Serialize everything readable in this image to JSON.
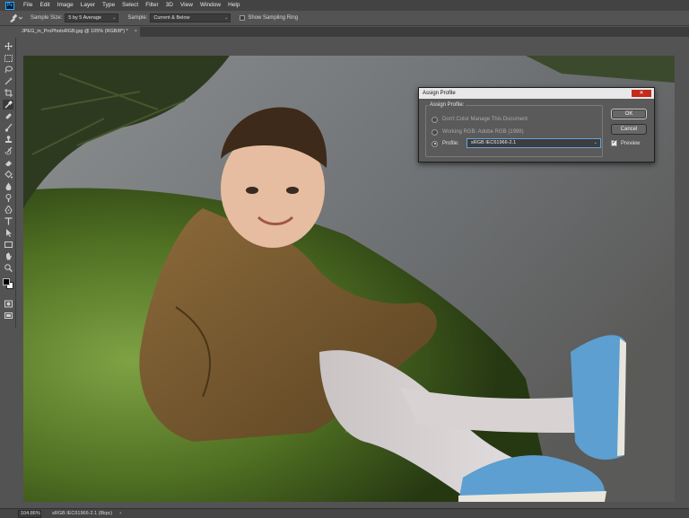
{
  "app": {
    "logo": "Ps",
    "menu": [
      "File",
      "Edit",
      "Image",
      "Layer",
      "Type",
      "Select",
      "Filter",
      "3D",
      "View",
      "Window",
      "Help"
    ]
  },
  "options": {
    "sample_size_label": "Sample Size:",
    "sample_size_value": "5 by 5 Average",
    "sample_label": "Sample:",
    "sample_value": "Current & Below",
    "sampling_ring_label": "Show Sampling Ring",
    "sampling_ring_checked": false
  },
  "document": {
    "tab_title": "JPEG_in_ProPhotoRGB.jpg @ 105% (RGB/8*) *",
    "close_glyph": "×"
  },
  "status": {
    "zoom": "104.86%",
    "info": "sRGB IEC61966-2.1 (8bpc)",
    "arrow": "›"
  },
  "dialog": {
    "title": "Assign Profile",
    "close_glyph": "✕",
    "group_label": "Assign Profile:",
    "options": [
      {
        "label": "Don't Color Manage This Document",
        "selected": false
      },
      {
        "label": "Working RGB:  Adobe RGB (1998)",
        "selected": false
      },
      {
        "label": "Profile:",
        "selected": true
      }
    ],
    "profile_value": "sRGB IEC61966-2.1",
    "ok_label": "OK",
    "cancel_label": "Cancel",
    "preview_label": "Preview",
    "preview_checked": true
  },
  "tools": [
    "move-tool-icon",
    "marquee-tool-icon",
    "lasso-tool-icon",
    "magic-wand-icon",
    "crop-tool-icon",
    "eyedropper-tool-icon",
    "healing-brush-icon",
    "brush-tool-icon",
    "clone-stamp-icon",
    "history-brush-icon",
    "eraser-tool-icon",
    "paint-bucket-icon",
    "blur-tool-icon",
    "dodge-tool-icon",
    "pen-tool-icon",
    "type-tool-icon",
    "path-selection-icon",
    "rectangle-tool-icon",
    "hand-tool-icon",
    "zoom-tool-icon"
  ]
}
